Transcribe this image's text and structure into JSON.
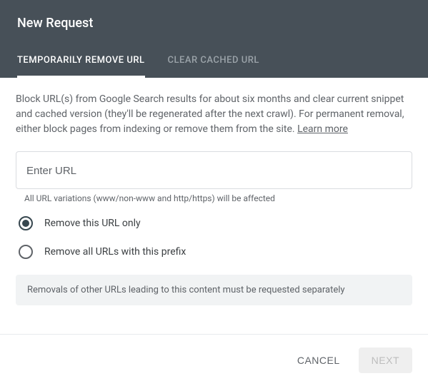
{
  "title": "New Request",
  "tabs": {
    "temp": "TEMPORARILY REMOVE URL",
    "clear": "CLEAR CACHED URL"
  },
  "description": "Block URL(s) from Google Search results for about six months and clear current snippet and cached version (they'll be regenerated after the next crawl). For permanent removal, either block pages from indexing or remove them from the site. ",
  "learn_more": "Learn more",
  "input": {
    "placeholder": "Enter URL",
    "helper": "All URL variations (www/non-www and http/https) will be affected"
  },
  "radio": {
    "only": "Remove this URL only",
    "prefix": "Remove all URLs with this prefix"
  },
  "banner": "Removals of other URLs leading to this content must be requested separately",
  "footer": {
    "cancel": "CANCEL",
    "next": "NEXT"
  }
}
